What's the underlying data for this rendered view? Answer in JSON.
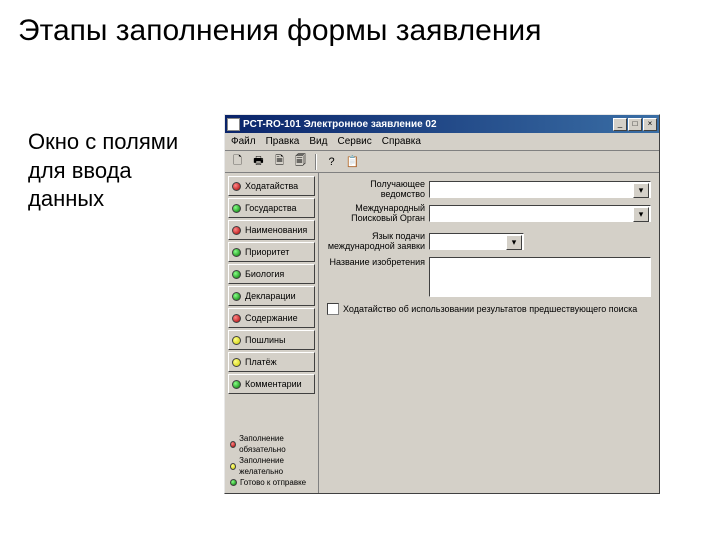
{
  "slide": {
    "title": "Этапы заполнения формы заявления",
    "caption": "Окно с полями для ввода данных"
  },
  "window": {
    "title": "PCT-RO-101 Электронное заявление 02"
  },
  "menu": {
    "file": "Файл",
    "edit": "Правка",
    "view": "Вид",
    "service": "Сервис",
    "help": "Справка"
  },
  "tabs": [
    {
      "label": "Ходатайства",
      "color": "red"
    },
    {
      "label": "Государства",
      "color": "green"
    },
    {
      "label": "Наименования",
      "color": "red"
    },
    {
      "label": "Приоритет",
      "color": "green"
    },
    {
      "label": "Биология",
      "color": "green"
    },
    {
      "label": "Декларации",
      "color": "green"
    },
    {
      "label": "Содержание",
      "color": "red"
    },
    {
      "label": "Пошлины",
      "color": "yellow"
    },
    {
      "label": "Платёж",
      "color": "yellow"
    },
    {
      "label": "Комментарии",
      "color": "green"
    }
  ],
  "legend": {
    "red": "Заполнение обязательно",
    "yellow": "Заполнение желательно",
    "green": "Готово к отправке"
  },
  "form": {
    "receivingOffice": "Получающее ведомство",
    "intlSearchAuthority": "Международный Поисковый Орган",
    "filingLanguage": "Язык подачи международной заявки",
    "inventionTitle": "Название изобретения",
    "checkboxLabel": "Ходатайство об использовании результатов предшествующего поиска"
  }
}
